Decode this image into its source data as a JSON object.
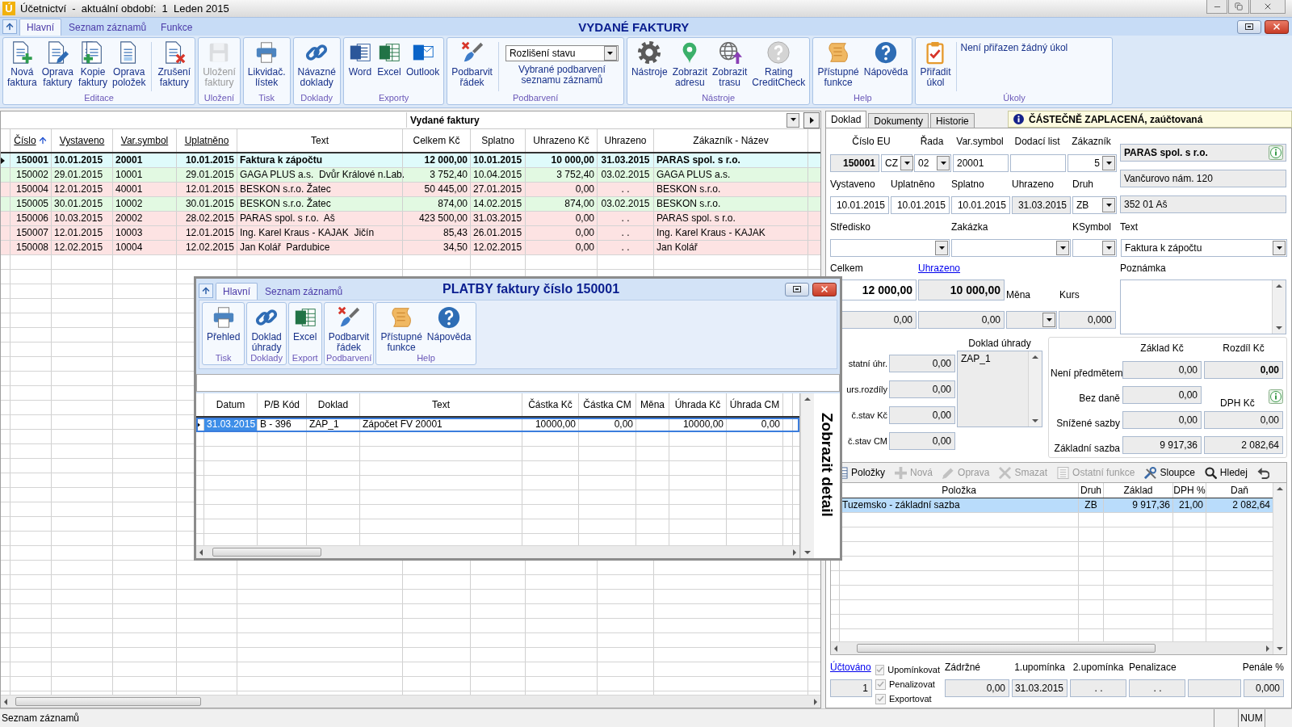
{
  "title_bar": {
    "app_icon": "Ú",
    "title": "Účetnictví  -  aktuální období:  1  Leden 2015"
  },
  "ribbon": {
    "tabs": [
      {
        "label": "Hlavní",
        "selected": true
      },
      {
        "label": "Seznam záznamů",
        "selected": false
      },
      {
        "label": "Funkce",
        "selected": false
      }
    ],
    "title": "VYDANÉ FAKTURY",
    "groups": [
      {
        "label": "Editace",
        "items": [
          {
            "kind": "button",
            "lines": [
              "Nová",
              "faktura"
            ],
            "disabled": false
          },
          {
            "kind": "button",
            "lines": [
              "Oprava",
              "faktury"
            ],
            "disabled": false
          },
          {
            "kind": "button",
            "lines": [
              "Kopie",
              "faktury"
            ],
            "disabled": false
          },
          {
            "kind": "button",
            "lines": [
              "Oprava",
              "položek"
            ],
            "disabled": false
          },
          {
            "kind": "separator"
          },
          {
            "kind": "button",
            "lines": [
              "Zrušení",
              "faktury"
            ],
            "disabled": false
          }
        ]
      },
      {
        "label": "Uložení",
        "items": [
          {
            "kind": "button",
            "lines": [
              "Uložení",
              "faktury"
            ],
            "disabled": true
          }
        ]
      },
      {
        "label": "Tisk",
        "items": [
          {
            "kind": "button",
            "lines": [
              "Likvidač.",
              "lístek"
            ],
            "disabled": false
          }
        ]
      },
      {
        "label": "Doklady",
        "items": [
          {
            "kind": "button",
            "lines": [
              "Návazné",
              "doklady"
            ],
            "disabled": false
          }
        ]
      },
      {
        "label": "Exporty",
        "items": [
          {
            "kind": "button",
            "lines": [
              "Word"
            ],
            "disabled": false
          },
          {
            "kind": "button",
            "lines": [
              "Excel"
            ],
            "disabled": false
          },
          {
            "kind": "button",
            "lines": [
              "Outlook"
            ],
            "disabled": false
          }
        ]
      },
      {
        "label": "Podbarvení",
        "items": [
          {
            "kind": "button",
            "lines": [
              "Podbarvit",
              "řádek"
            ],
            "disabled": false
          },
          {
            "kind": "separator"
          },
          {
            "kind": "select",
            "value": "Rozlišení stavu",
            "caption": "Vybrané podbarvení seznamu záznamů"
          }
        ]
      },
      {
        "label": "Nástroje",
        "items": [
          {
            "kind": "button",
            "lines": [
              "Nástroje"
            ],
            "disabled": false
          },
          {
            "kind": "button",
            "lines": [
              "Zobrazit",
              "adresu"
            ],
            "disabled": false
          },
          {
            "kind": "button",
            "lines": [
              "Zobrazit",
              "trasu"
            ],
            "disabled": false
          },
          {
            "kind": "button",
            "lines": [
              "Rating",
              "CreditCheck"
            ],
            "disabled": false
          }
        ]
      },
      {
        "label": "Help",
        "items": [
          {
            "kind": "button",
            "lines": [
              "Přístupné",
              "funkce"
            ],
            "disabled": false
          },
          {
            "kind": "button",
            "lines": [
              "Nápověda"
            ],
            "disabled": false
          }
        ]
      },
      {
        "label": "Úkoly",
        "items": [
          {
            "kind": "button",
            "lines": [
              "Přiřadit",
              "úkol"
            ],
            "disabled": false
          },
          {
            "kind": "separator"
          },
          {
            "kind": "note",
            "text": "Není přiřazen žádný úkol"
          }
        ]
      }
    ]
  },
  "invoice_list": {
    "filter_title": "Vydané faktury",
    "columns": [
      {
        "label": "Číslo",
        "link": true,
        "sorted": true
      },
      {
        "label": "Vystaveno",
        "link": true,
        "sorted": false
      },
      {
        "label": "Var.symbol",
        "link": true,
        "sorted": false
      },
      {
        "label": "Uplatněno",
        "link": true,
        "sorted": false
      },
      {
        "label": "Text",
        "link": false,
        "sorted": false
      },
      {
        "label": "Celkem Kč",
        "link": false,
        "sorted": false
      },
      {
        "label": "Splatno",
        "link": false,
        "sorted": false
      },
      {
        "label": "Uhrazeno Kč",
        "link": false,
        "sorted": false
      },
      {
        "label": "Uhrazeno",
        "link": false,
        "sorted": false
      },
      {
        "label": "Zákazník - Název",
        "link": false,
        "sorted": false
      }
    ],
    "rows": [
      {
        "cells": [
          "150001",
          "10.01.2015",
          "20001",
          "10.01.2015",
          "Faktura k zápočtu",
          "12 000,00",
          "10.01.2015",
          "10 000,00",
          "31.03.2015",
          "PARAS spol. s r.o."
        ],
        "selected": true,
        "color": "#dffbfb"
      },
      {
        "cells": [
          "150002",
          "29.01.2015",
          "10001",
          "29.01.2015",
          "GAGA PLUS a.s.  Dvůr Králové n.Lab.",
          "3 752,40",
          "10.04.2015",
          "3 752,40",
          "03.02.2015",
          "GAGA PLUS a.s."
        ],
        "selected": false,
        "color": "#e2f9e2"
      },
      {
        "cells": [
          "150004",
          "12.01.2015",
          "40001",
          "12.01.2015",
          "BESKON s.r.o. Žatec",
          "50 445,00",
          "27.01.2015",
          "0,00",
          ". .",
          "BESKON s.r.o."
        ],
        "selected": false,
        "color": "#fde3e3"
      },
      {
        "cells": [
          "150005",
          "30.01.2015",
          "10002",
          "30.01.2015",
          "BESKON s.r.o. Žatec",
          "874,00",
          "14.02.2015",
          "874,00",
          "03.02.2015",
          "BESKON s.r.o."
        ],
        "selected": false,
        "color": "#e2f9e2"
      },
      {
        "cells": [
          "150006",
          "10.03.2015",
          "20002",
          "28.02.2015",
          "PARAS spol. s r.o.  Aš",
          "423 500,00",
          "31.03.2015",
          "0,00",
          ". .",
          "PARAS spol. s r.o."
        ],
        "selected": false,
        "color": "#fde3e3"
      },
      {
        "cells": [
          "150007",
          "12.01.2015",
          "10003",
          "12.01.2015",
          "Ing. Karel Kraus - KAJAK  Jičín",
          "85,43",
          "26.01.2015",
          "0,00",
          ". .",
          "Ing. Karel Kraus - KAJAK"
        ],
        "selected": false,
        "color": "#fde3e3"
      },
      {
        "cells": [
          "150008",
          "12.02.2015",
          "10004",
          "12.02.2015",
          "Jan Kolář  Pardubice",
          "34,50",
          "12.02.2015",
          "0,00",
          ". .",
          "Jan Kolář"
        ],
        "selected": false,
        "color": "#fde3e3"
      }
    ]
  },
  "payments_dialog": {
    "tabs": [
      {
        "label": "Hlavní",
        "selected": true
      },
      {
        "label": "Seznam záznamů",
        "selected": false
      }
    ],
    "title": "PLATBY faktury číslo 150001",
    "groups": [
      {
        "label": "Tisk",
        "items": [
          {
            "kind": "button",
            "lines": [
              "Přehled"
            ],
            "disabled": false
          }
        ]
      },
      {
        "label": "Doklady",
        "items": [
          {
            "kind": "button",
            "lines": [
              "Doklad",
              "úhrady"
            ],
            "disabled": false
          }
        ]
      },
      {
        "label": "Export",
        "items": [
          {
            "kind": "button",
            "lines": [
              "Excel"
            ],
            "disabled": false
          }
        ]
      },
      {
        "label": "Podbarvení",
        "items": [
          {
            "kind": "button",
            "lines": [
              "Podbarvit",
              "řádek"
            ],
            "disabled": false
          }
        ]
      },
      {
        "label": "Help",
        "items": [
          {
            "kind": "button",
            "lines": [
              "Přístupné",
              "funkce"
            ],
            "disabled": false
          },
          {
            "kind": "button",
            "lines": [
              "Nápověda"
            ],
            "disabled": false
          }
        ]
      }
    ],
    "columns": [
      "Datum",
      "P/B Kód",
      "Doklad",
      "Text",
      "Částka Kč",
      "Částka CM",
      "Měna",
      "Úhrada Kč",
      "Úhrada CM"
    ],
    "rows": [
      {
        "cells": [
          "31.03.2015",
          "B - 396",
          "ZAP_1",
          "Zápočet FV 20001",
          "10000,00",
          "0,00",
          null,
          "10000,00",
          "0,00"
        ],
        "selected": true
      }
    ],
    "side_button": "Zobrazit detail"
  },
  "detail": {
    "tabs": [
      {
        "label": "Doklad",
        "selected": true
      },
      {
        "label": "Dokumenty",
        "selected": false
      },
      {
        "label": "Historie",
        "selected": false
      }
    ],
    "status": "ČÁSTEČNĚ ZAPLACENÁ, zaúčtovaná",
    "head": {
      "labels": [
        "Číslo EU",
        "Řada",
        "Var.symbol",
        "Dodací list",
        "Zákazník"
      ],
      "number": "150001",
      "country": "CZ",
      "series": "02",
      "var_symbol": "20001",
      "customer_no": "5"
    },
    "customer": {
      "name": "PARAS spol. s r.o.",
      "street": "Vančurovo nám. 120",
      "city": "352 01 Aš"
    },
    "dates": {
      "labels": [
        "Vystaveno",
        "Uplatněno",
        "Splatno",
        "Uhrazeno",
        "Druh"
      ],
      "issued": "10.01.2015",
      "claimed": "10.01.2015",
      "due": "10.01.2015",
      "paid": "31.03.2015",
      "type_code": "ZB"
    },
    "assign": {
      "labels": [
        "Středisko",
        "Zakázka",
        "KSymbol",
        "Text"
      ],
      "text": "Faktura k zápočtu"
    },
    "amounts": {
      "total_label": "Celkem",
      "paid_label": "Uhrazeno",
      "note_label": "Poznámka",
      "total": "12 000,00",
      "paid": "10 000,00",
      "currency_label": "Měna",
      "rate_label": "Kurs",
      "total_cm": "0,00",
      "paid_cm": "0,00",
      "rate": "0,000"
    },
    "other": [
      {
        "label": "statní úhr.",
        "value": "0,00"
      },
      {
        "label": "urs.rozdíly",
        "value": "0,00"
      },
      {
        "label": "č.stav Kč",
        "value": "0,00"
      },
      {
        "label": "č.stav CM",
        "value": "0,00"
      }
    ],
    "payment_docs": {
      "label": "Doklad úhrady",
      "items": [
        "ZAP_1"
      ]
    },
    "vat": {
      "columns": [
        "Základ Kč",
        "Rozdíl Kč"
      ],
      "rows": [
        {
          "kind": "pair",
          "label": "Není předmětem",
          "base": "0,00",
          "diff": "0,00",
          "bold": true
        },
        {
          "kind": "dph",
          "label": "Bez daně",
          "base": "0,00",
          "dph_label": "DPH Kč"
        },
        {
          "kind": "pair",
          "label": "Snížené sazby",
          "base": "0,00",
          "diff": "0,00",
          "bold": false
        },
        {
          "kind": "pair",
          "label": "Základní sazba",
          "base": "9 917,36",
          "diff": "2 082,64",
          "bold": false
        }
      ]
    },
    "toolbar": [
      {
        "label": "Položky",
        "disabled": false
      },
      {
        "label": "Nová",
        "disabled": true
      },
      {
        "label": "Oprava",
        "disabled": true
      },
      {
        "label": "Smazat",
        "disabled": true
      },
      {
        "label": "Ostatní funkce",
        "disabled": true
      },
      {
        "label": "Sloupce",
        "disabled": false
      },
      {
        "label": "Hledej",
        "disabled": false
      },
      {
        "disabled": false
      }
    ],
    "items": {
      "columns": [
        "Položka",
        "Druh",
        "Základ",
        "DPH %",
        "Daň"
      ],
      "rows": [
        {
          "cells": [
            "Tuzemsko - základní sazba",
            "ZB",
            "9 917,36",
            "21,00",
            "2 082,64"
          ],
          "selected": true
        }
      ]
    },
    "footer": {
      "posted_link": "Účtováno",
      "posted_count": "1",
      "checks": [
        {
          "label": "Upomínkovat",
          "checked": true,
          "disabled": true
        },
        {
          "label": "Penalizovat",
          "checked": true,
          "disabled": true
        },
        {
          "label": "Exportovat",
          "checked": true,
          "disabled": true
        }
      ],
      "fields": [
        {
          "kind": "field",
          "label": "Zádržné",
          "value": "0,00"
        },
        {
          "kind": "field",
          "label": "1.upomínka",
          "value": "31.03.2015"
        },
        {
          "kind": "field",
          "label": "2.upomínka",
          "value": ". ."
        },
        {
          "kind": "field",
          "label": "Penalizace",
          "value": ". ."
        },
        {
          "kind": "blank"
        },
        {
          "kind": "field",
          "label": "Penále %",
          "value": "0,000"
        }
      ]
    }
  },
  "status_bar": {
    "text": "Seznam záznamů",
    "num": "NUM"
  }
}
